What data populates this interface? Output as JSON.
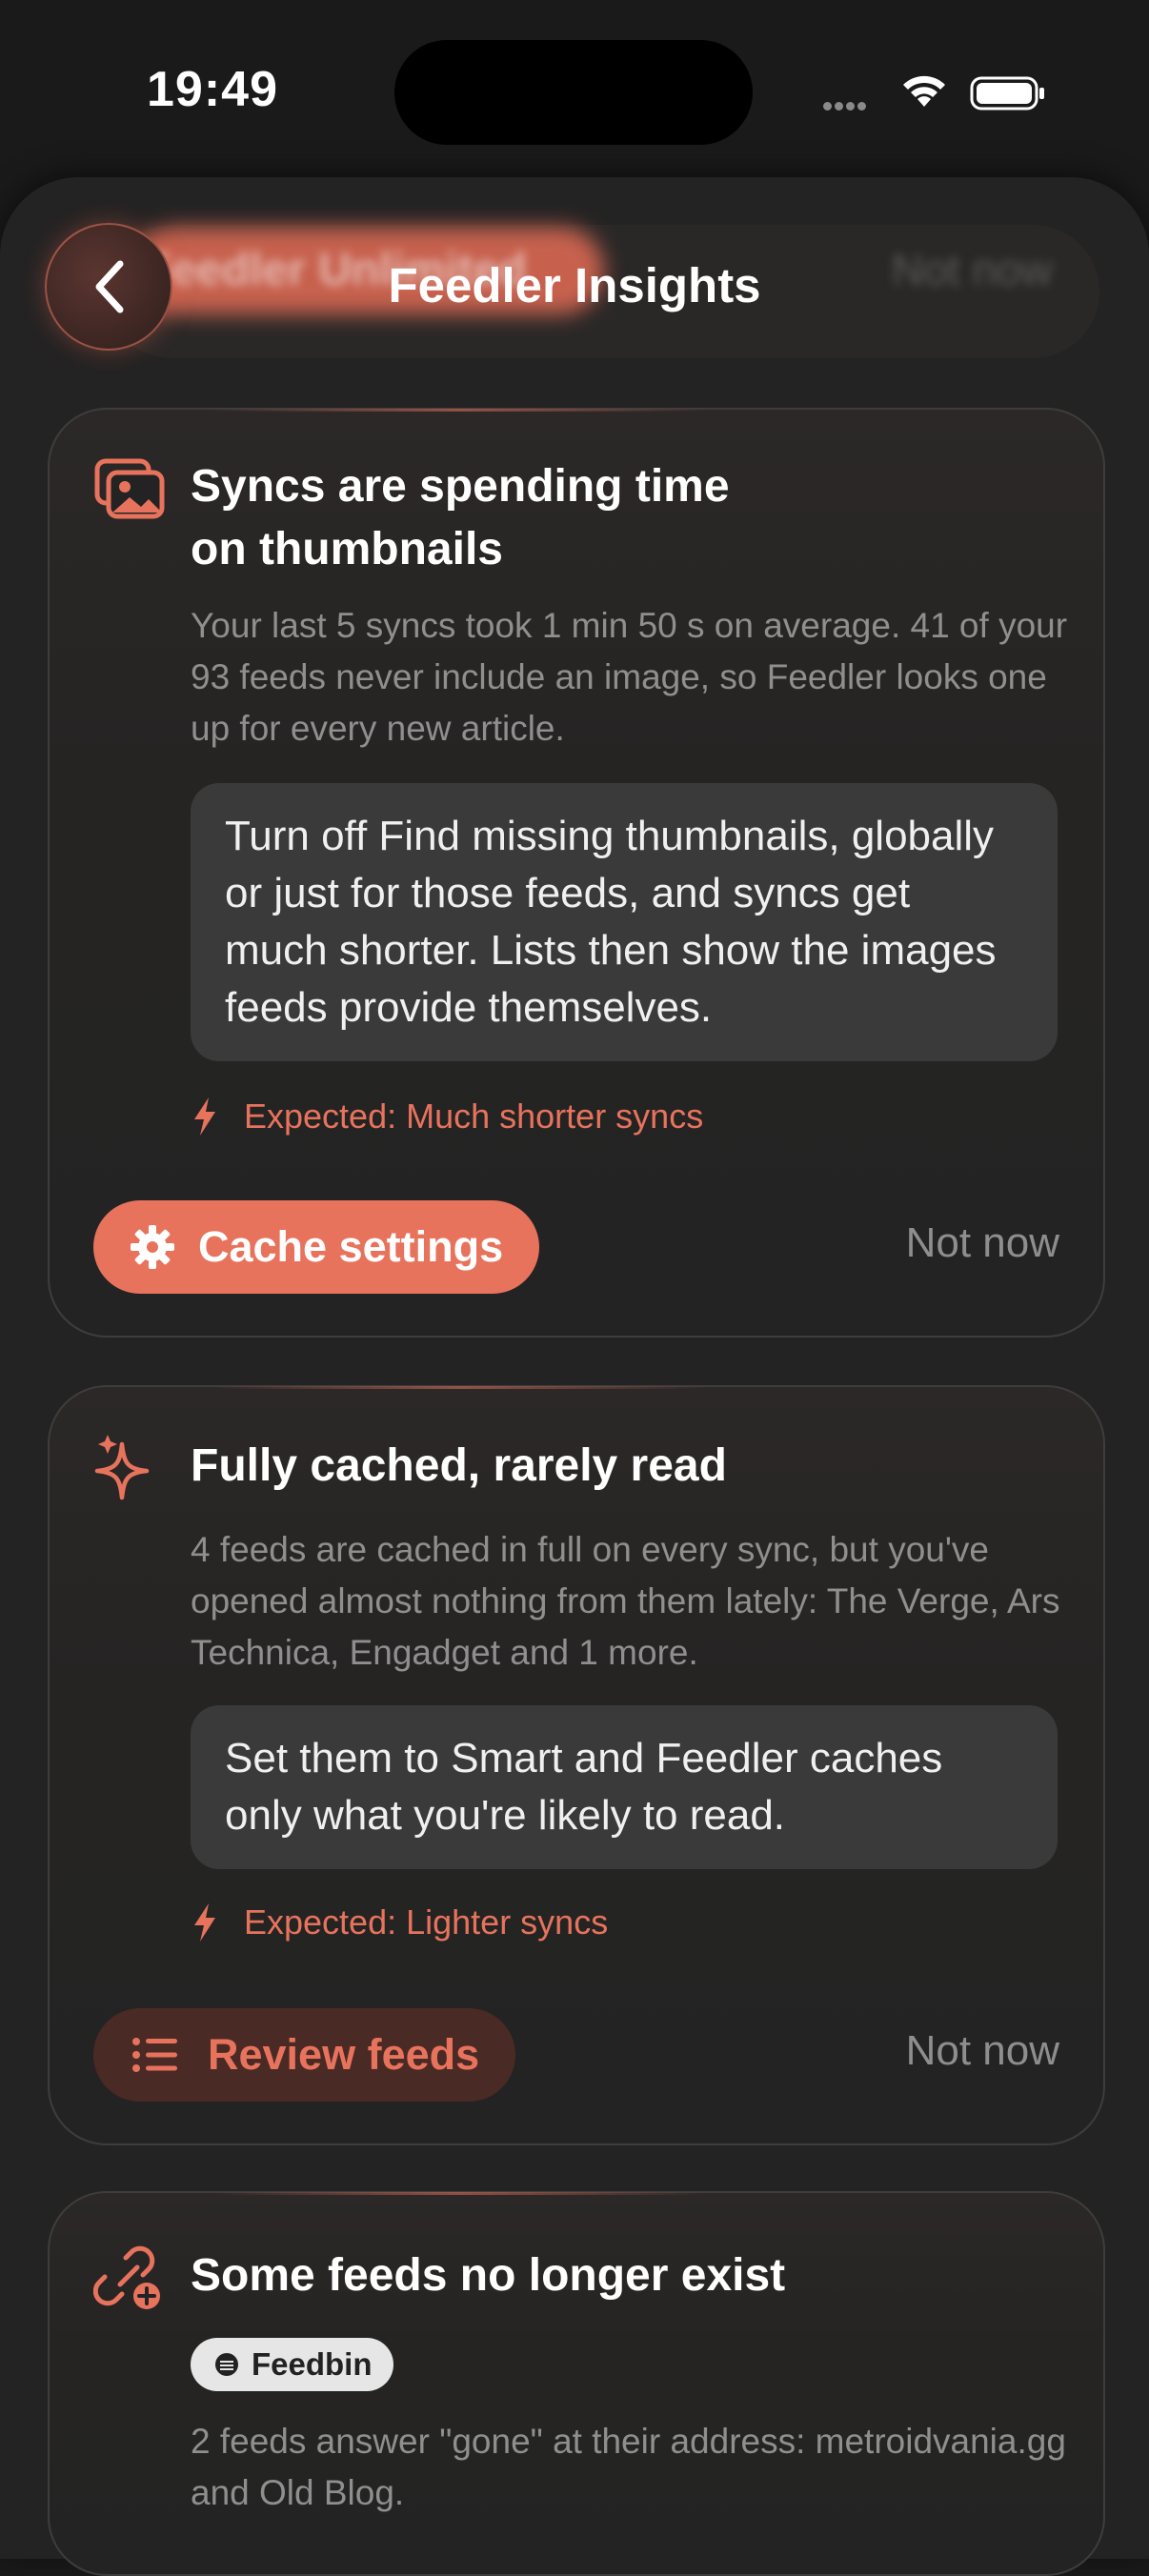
{
  "status_bar": {
    "time": "19:49"
  },
  "nav": {
    "title": "Feedler Insights",
    "ghost_button_label": "Feedler Unlimited",
    "ghost_not_now": "Not now"
  },
  "cards": [
    {
      "icon": "photo-stack-icon",
      "title_line1": "Syncs are spending time",
      "title_line2": "on thumbnails",
      "description": "Your last 5 syncs took 1 min 50 s on average. 41 of your 93 feeds never include an image, so Feedler looks one up for every new article.",
      "suggestion": "Turn off Find missing thumbnails, globally or just for those feeds, and syncs get much shorter. Lists then show the images feeds provide themselves.",
      "expected": "Expected: Much shorter syncs",
      "primary_action": "Cache settings",
      "dismiss": "Not now"
    },
    {
      "icon": "sparkles-icon",
      "title_line1": "Fully cached, rarely read",
      "description": "4 feeds are cached in full on every sync, but you've opened almost nothing from them lately: The Verge, Ars Technica, Engadget and 1 more.",
      "suggestion": "Set them to Smart and Feedler caches only what you're likely to read.",
      "expected": "Expected: Lighter syncs",
      "secondary_action": "Review feeds",
      "dismiss": "Not now"
    },
    {
      "icon": "link-add-icon",
      "title_line1": "Some feeds no longer exist",
      "badge": "Feedbin",
      "description": "2 feeds answer \"gone\" at their address: metroidvania.gg and Old Blog."
    }
  ],
  "colors": {
    "accent": "#e8735d",
    "background": "#1a1a1a",
    "sheet": "#242323",
    "suggestion_bg": "#3a3a3a"
  }
}
